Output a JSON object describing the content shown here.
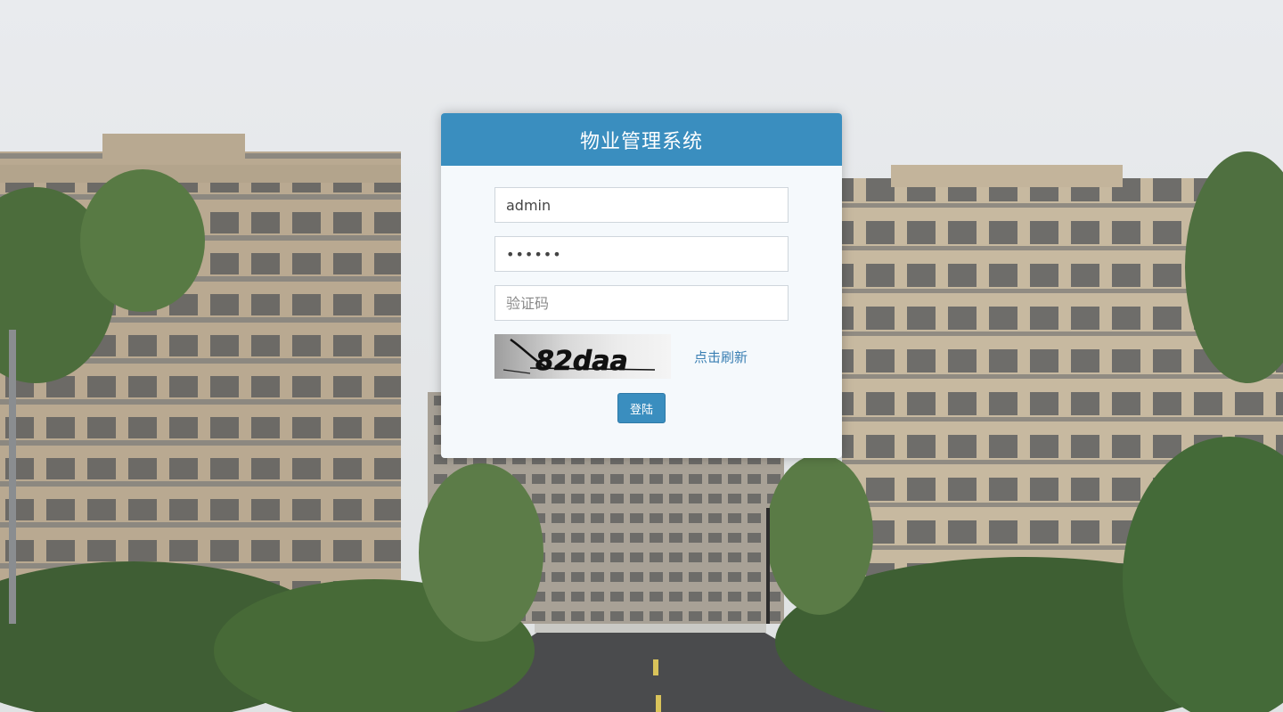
{
  "header": {
    "title": "物业管理系统"
  },
  "form": {
    "username_value": "admin",
    "password_value": "••••••",
    "captcha_placeholder": "验证码",
    "captcha_image_text": "82daa",
    "refresh_label": "点击刷新",
    "login_label": "登陆"
  },
  "colors": {
    "accent": "#3a8ebf",
    "link": "#3a7fb3",
    "card_bg": "#f5f9fc"
  }
}
